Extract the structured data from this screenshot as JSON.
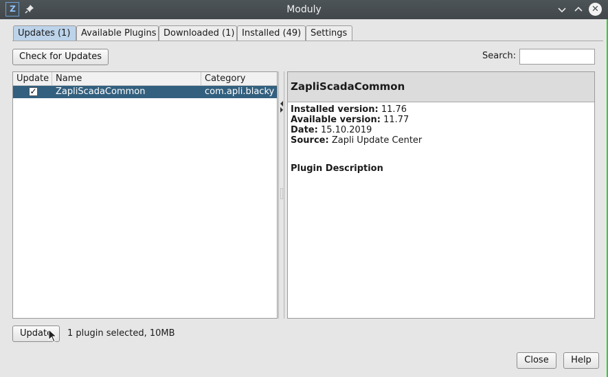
{
  "window": {
    "title": "Moduly",
    "app_icon": "Z",
    "icons": {
      "app": "zapli-app-icon",
      "pin": "pin-icon",
      "minimize": "chevron-down-icon",
      "maximize": "chevron-up-icon",
      "close": "close-icon"
    }
  },
  "tabs": [
    {
      "label": "Updates (1)",
      "active": true
    },
    {
      "label": "Available Plugins",
      "active": false
    },
    {
      "label": "Downloaded (1)",
      "active": false
    },
    {
      "label": "Installed (49)",
      "active": false
    },
    {
      "label": "Settings",
      "active": false
    }
  ],
  "toolbar": {
    "check_updates_label": "Check for Updates",
    "search_label": "Search:",
    "search_value": ""
  },
  "table": {
    "columns": [
      "Update",
      "Name",
      "Category"
    ],
    "rows": [
      {
        "checked": true,
        "check_glyph": "✓",
        "name": "ZapliScadaCommon",
        "category": "com.apli.blacky"
      }
    ]
  },
  "detail": {
    "title": "ZapliScadaCommon",
    "installed_label": "Installed version:",
    "installed_value": "11.76",
    "available_label": "Available version:",
    "available_value": "11.77",
    "date_label": "Date:",
    "date_value": "15.10.2019",
    "source_label": "Source:",
    "source_value": "Zapli Update Center",
    "description_title": "Plugin Description"
  },
  "footer": {
    "update_label": "Update",
    "status_text": "1 plugin selected, 10MB",
    "close_label": "Close",
    "help_label": "Help"
  },
  "colors": {
    "selected_row": "#33607f",
    "active_tab": "#bcd3ea",
    "titlebar": "#454b4f"
  }
}
